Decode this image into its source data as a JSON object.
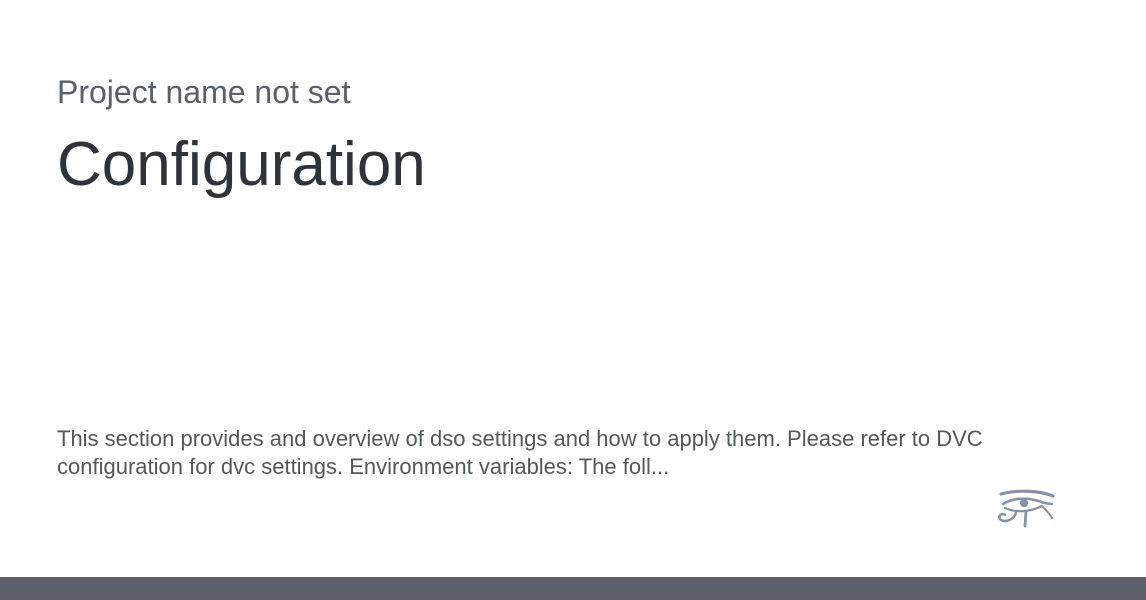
{
  "header": {
    "project_name": "Project name not set",
    "title": "Configuration"
  },
  "main": {
    "description": "This section provides and overview of dso settings and how to apply them. Please refer to DVC configuration for dvc settings. Environment variables: The foll..."
  },
  "logo": {
    "icon": "eye-of-horus-icon",
    "color": "#8a90a8"
  },
  "footer": {
    "bar_color": "#5c606b"
  }
}
